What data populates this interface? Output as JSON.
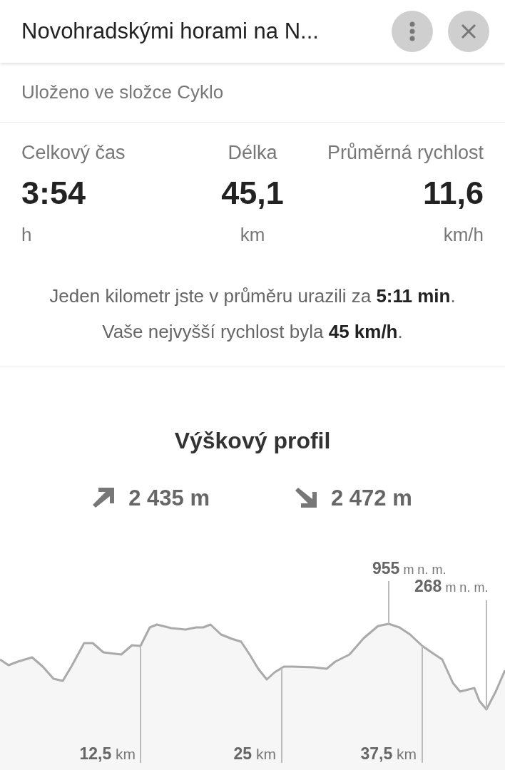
{
  "header": {
    "title": "Novohradskými horami na N..."
  },
  "folder": "Uloženo ve složce Cyklo",
  "stats": [
    {
      "label": "Celkový čas",
      "value": "3:54",
      "unit": "h"
    },
    {
      "label": "Délka",
      "value": "45,1",
      "unit": "km"
    },
    {
      "label": "Průměrná rychlost",
      "value": "11,6",
      "unit": "km/h"
    }
  ],
  "notes": [
    "Jeden kilometr jste v průměru urazili za **5:11 min**.",
    "Vaše nejvyšší rychlost byla **45 km/h**."
  ],
  "elevation": {
    "title": "Výškový profil",
    "ascent": "2 435 m",
    "descent": "2 472 m",
    "markers": [
      {
        "kind": "max",
        "label": "**955** m n. m."
      },
      {
        "kind": "min",
        "label": "**268** m n. m."
      }
    ],
    "distances": [
      "**12,5** km",
      "**25** km",
      "**37,5** km"
    ]
  }
}
